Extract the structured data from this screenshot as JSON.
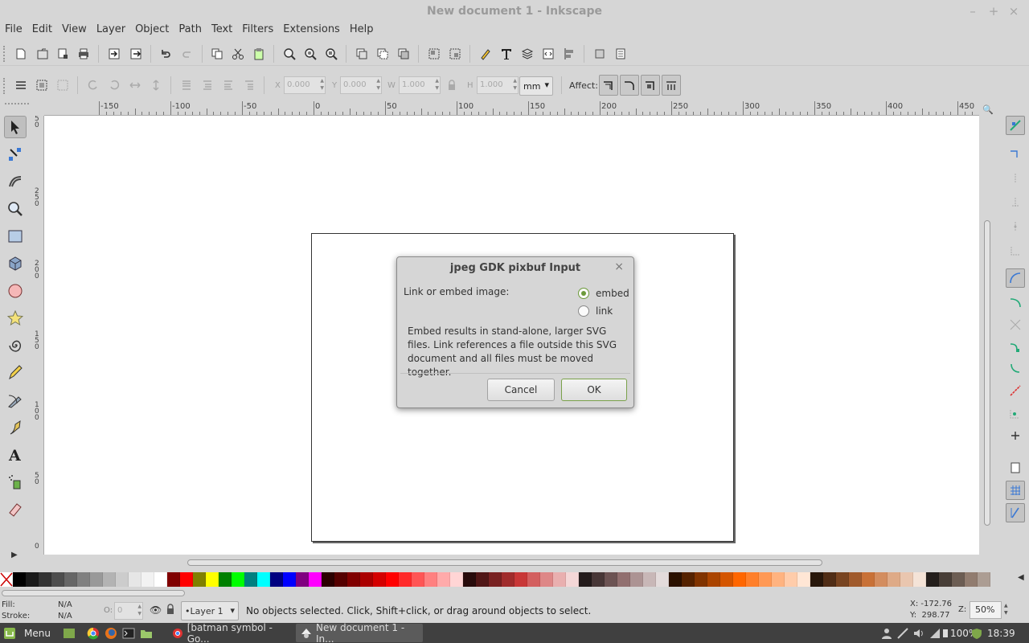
{
  "window": {
    "title": "New document 1 - Inkscape"
  },
  "menu": [
    "File",
    "Edit",
    "View",
    "Layer",
    "Object",
    "Path",
    "Text",
    "Filters",
    "Extensions",
    "Help"
  ],
  "toolbar2": {
    "x_label": "X",
    "x_value": "0.000",
    "y_label": "Y",
    "y_value": "0.000",
    "w_label": "W",
    "w_value": "1.000",
    "h_label": "H",
    "h_value": "1.000",
    "unit": "mm",
    "affect_label": "Affect:"
  },
  "ruler": {
    "h_labels": [
      "-150",
      "-100",
      "-50",
      "0",
      "50",
      "100",
      "150",
      "200",
      "250",
      "300",
      "350",
      "400",
      "450"
    ],
    "v_labels": [
      "5\n0",
      "2\n5\n0",
      "2\n0\n0",
      "1\n5\n0",
      "1\n0\n0",
      "5\n0",
      "0"
    ]
  },
  "dialog": {
    "title": "jpeg GDK pixbuf Input",
    "close": "×",
    "prompt": "Link or embed image:",
    "option_embed": "embed",
    "option_link": "link",
    "selected": "embed",
    "help": "Embed results in stand-alone, larger SVG files. Link references a file outside this SVG document and all files must be moved together.",
    "cancel": "Cancel",
    "ok": "OK"
  },
  "palette": [
    "#000000",
    "#1a1a1a",
    "#333333",
    "#4d4d4d",
    "#666666",
    "#808080",
    "#999999",
    "#b3b3b3",
    "#cccccc",
    "#e6e6e6",
    "#f2f2f2",
    "#ffffff",
    "#800000",
    "#ff0000",
    "#808000",
    "#ffff00",
    "#008000",
    "#00ff00",
    "#008080",
    "#00ffff",
    "#000080",
    "#0000ff",
    "#800080",
    "#ff00ff",
    "#2b0000",
    "#550000",
    "#800000",
    "#aa0000",
    "#d40000",
    "#ff0000",
    "#ff2a2a",
    "#ff5555",
    "#ff8080",
    "#ffaaaa",
    "#ffd5d5",
    "#280b0b",
    "#501616",
    "#782121",
    "#a02c2c",
    "#c83737",
    "#d35f5f",
    "#de8787",
    "#e9afaf",
    "#f4d7d7",
    "#241c1c",
    "#483737",
    "#6c5353",
    "#916f6f",
    "#ac9393",
    "#c8b7b7",
    "#e3dbdb",
    "#2b1100",
    "#552200",
    "#803300",
    "#aa4400",
    "#d45500",
    "#ff6600",
    "#ff7f2a",
    "#ff9955",
    "#ffb380",
    "#ffccaa",
    "#ffe6d5",
    "#28170b",
    "#502d16",
    "#784421",
    "#a05a2c",
    "#c87137",
    "#d38d5f",
    "#deaa87",
    "#e9c6af",
    "#f4e3d7",
    "#241f1c",
    "#483e37",
    "#6c5d53",
    "#917c6f",
    "#ac9d93"
  ],
  "status": {
    "fill_label": "Fill:",
    "fill_value": "N/A",
    "stroke_label": "Stroke:",
    "stroke_value": "N/A",
    "opacity_label": "O:",
    "opacity_value": "0",
    "layer": "•Layer 1",
    "message": "No objects selected. Click, Shift+click, or drag around objects to select.",
    "x_coord": "X: -172.76",
    "y_coord": "Y:  298.77",
    "zoom_label": "Z:",
    "zoom_value": "50%"
  },
  "taskbar": {
    "menu_label": "Menu",
    "windows": [
      "[batman symbol - Go...",
      "New document 1 - In..."
    ],
    "battery": "100%",
    "time": "18:39"
  }
}
